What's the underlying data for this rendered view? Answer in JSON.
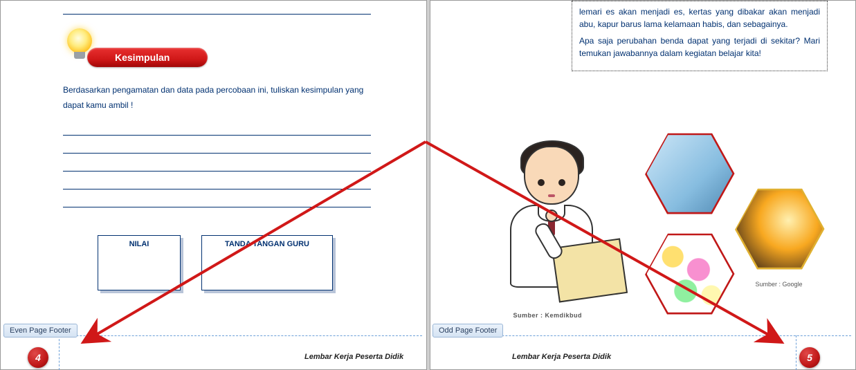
{
  "leftPage": {
    "kesimpulanLabel": "Kesimpulan",
    "instruction": "Berdasarkan pengamatan dan data pada percobaan ini, tuliskan kesimpulan yang dapat kamu ambil !",
    "nilaiLabel": "NILAI",
    "ttdLabel": "TANDA TANGAN GURU"
  },
  "rightPage": {
    "paragraph1": "lemari es akan menjadi es, kertas yang dibakar akan menjadi abu, kapur barus lama kelamaan habis, dan sebagainya.",
    "paragraph2": "Apa saja perubahan benda dapat yang terjadi di sekitar? Mari temukan jawabannya dalam kegiatan belajar kita!",
    "sumberBoy": "Sumber : Kemdikbud",
    "sumberHex": "Sumber : Google"
  },
  "footers": {
    "evenTab": "Even Page Footer",
    "oddTab": "Odd Page Footer",
    "centerText": "Lembar Kerja Peserta Didik",
    "badgeLeft": "4",
    "badgeRight": "5"
  }
}
